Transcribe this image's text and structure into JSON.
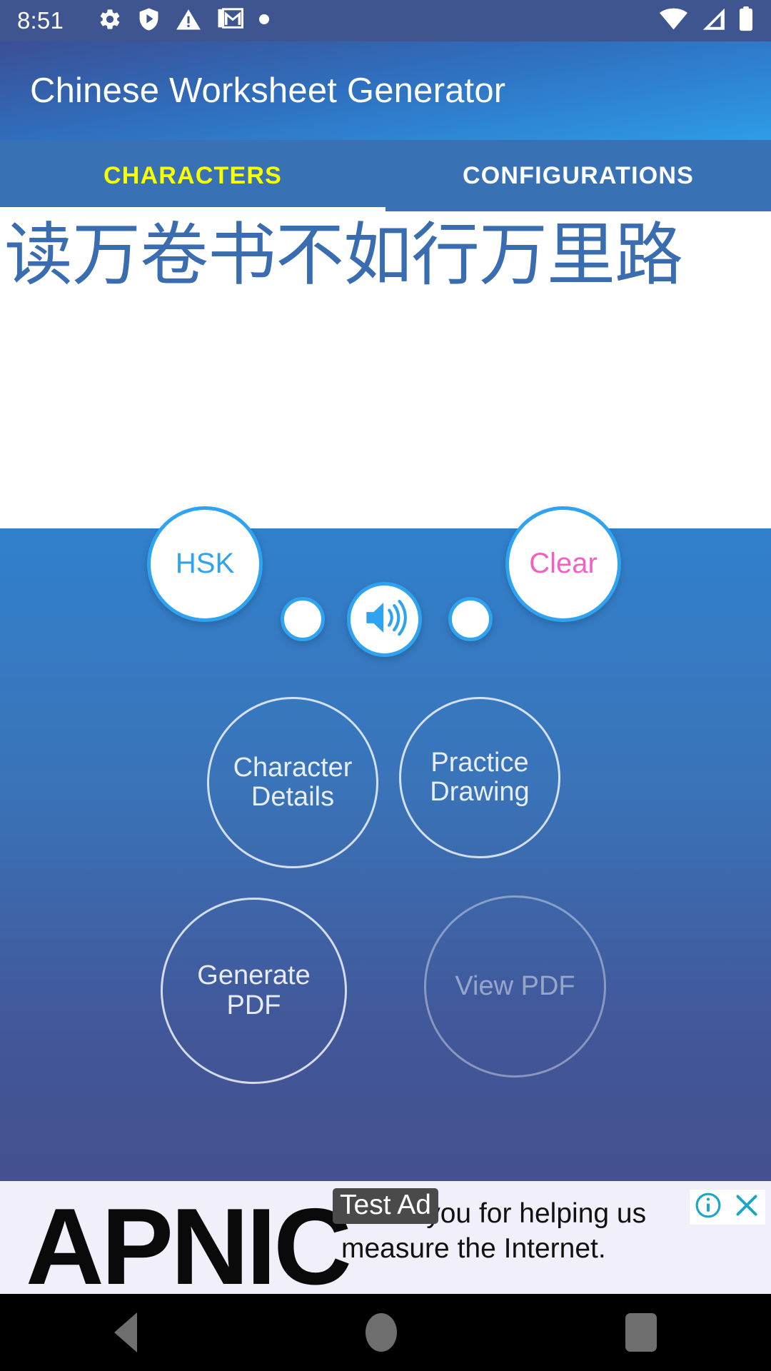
{
  "status_bar": {
    "time": "8:51",
    "left_icons": [
      "gear-icon",
      "shield-play-icon",
      "warning-triangle-icon",
      "gmail-icon",
      "dot-icon"
    ],
    "right_icons": [
      "wifi-icon",
      "cellular-signal-icon",
      "battery-icon"
    ]
  },
  "app_bar": {
    "title": "Chinese Worksheet Generator"
  },
  "tabs": {
    "items": [
      {
        "label": "CHARACTERS",
        "active": true
      },
      {
        "label": "CONFIGURATIONS",
        "active": false
      }
    ],
    "active_color": "#FAFF00",
    "inactive_color": "#FFFFFF",
    "bar_color": "#3871B4"
  },
  "characters_panel": {
    "text": "读万卷书不如行万里路",
    "text_color": "#3A6CB0",
    "background": "#FFFFFF"
  },
  "controls": {
    "hsk": {
      "label": "HSK",
      "color": "#2FA3F0"
    },
    "clear": {
      "label": "Clear",
      "color": "#F55FC0"
    },
    "dot_left": {
      "label": "",
      "icon": "empty-circle-icon"
    },
    "speaker": {
      "label": "",
      "icon": "volume-up-icon",
      "color": "#2FA3F0"
    },
    "dot_right": {
      "label": "",
      "icon": "empty-circle-icon"
    },
    "character_details": {
      "label": "Character\nDetails",
      "line1": "Character",
      "line2": "Details",
      "enabled": true
    },
    "practice_drawing": {
      "label": "Practice\nDrawing",
      "line1": "Practice",
      "line2": "Drawing",
      "enabled": true
    },
    "generate_pdf": {
      "label": "Generate\nPDF",
      "line1": "Generate",
      "line2": "PDF",
      "enabled": true
    },
    "view_pdf": {
      "label": "View PDF",
      "line1": "View PDF",
      "line2": "",
      "enabled": false
    }
  },
  "background": {
    "gradient_top": "#3180CC",
    "gradient_bottom": "#44508F"
  },
  "ad": {
    "logo_text": "APNIC",
    "badge": "Test Ad",
    "body_text": "Thank you for helping us measure the Internet.",
    "info_icon": "info-circle-icon",
    "close_icon": "close-x-icon",
    "accent_color": "#1BA7C4"
  },
  "nav_bar": {
    "back": "back-triangle-icon",
    "home": "home-circle-icon",
    "recents": "recents-square-icon"
  }
}
